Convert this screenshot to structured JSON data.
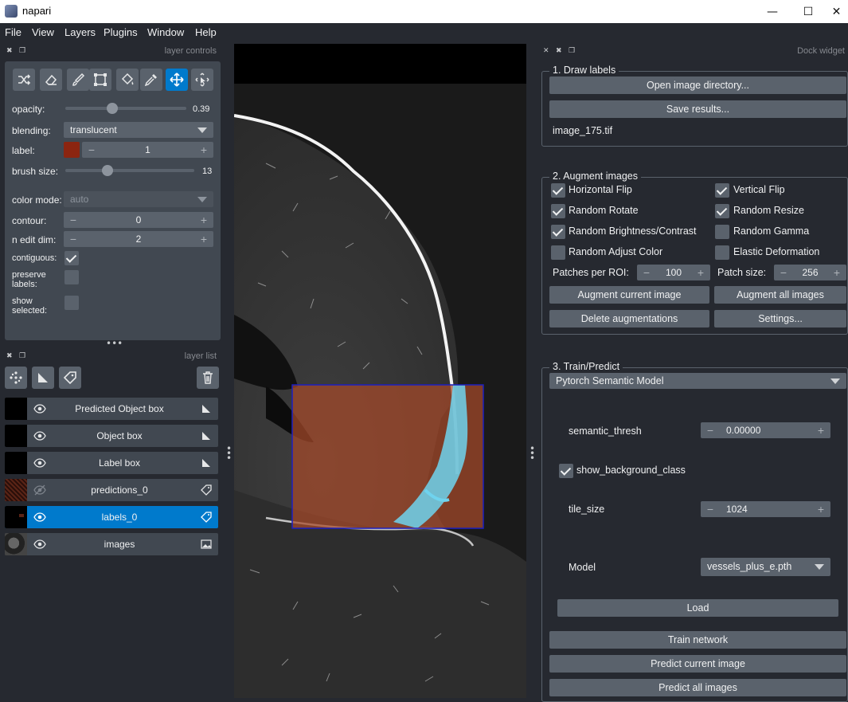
{
  "window": {
    "title": "napari",
    "minimize_icon": "minimize-icon",
    "maximize_icon": "maximize-icon",
    "close_icon": "close-icon"
  },
  "menu": [
    "File",
    "View",
    "Layers",
    "Plugins",
    "Window",
    "Help"
  ],
  "layer_controls": {
    "header": "layer controls",
    "tools": [
      "shuffle-colors-icon",
      "eraser-icon",
      "paintbrush-icon",
      "polygon-icon",
      "fill-bucket-icon",
      "color-picker-icon",
      "pan-zoom-icon",
      "transform-icon"
    ],
    "active_tool": "pan-zoom-icon",
    "opacity_label": "opacity:",
    "opacity_value": "0.39",
    "opacity_fraction": 0.39,
    "blending_label": "blending:",
    "blending_value": "translucent",
    "label_label": "label:",
    "label_value": "1",
    "label_color": "#8b2510",
    "brush_label": "brush size:",
    "brush_value": "13",
    "brush_fraction": 0.33,
    "color_mode_label": "color mode:",
    "color_mode_value": "auto",
    "contour_label": "contour:",
    "contour_value": "0",
    "n_edit_label": "n edit dim:",
    "n_edit_value": "2",
    "contiguous_label": "contiguous:",
    "contiguous_checked": true,
    "preserve_label_1": "preserve",
    "preserve_label_2": "labels:",
    "preserve_checked": false,
    "show_label_1": "show",
    "show_label_2": "selected:",
    "show_checked": false
  },
  "layer_list": {
    "header": "layer list",
    "buttons": [
      "new-points-icon",
      "new-shapes-icon",
      "new-labels-icon",
      "delete-layer-icon"
    ],
    "layers": [
      {
        "name": "Predicted Object box",
        "visible": true,
        "type": "shapes",
        "selected": false
      },
      {
        "name": "Object box",
        "visible": true,
        "type": "shapes",
        "selected": false
      },
      {
        "name": "Label box",
        "visible": true,
        "type": "shapes",
        "selected": false
      },
      {
        "name": "predictions_0",
        "visible": false,
        "type": "labels",
        "selected": false
      },
      {
        "name": "labels_0",
        "visible": true,
        "type": "labels",
        "selected": true
      },
      {
        "name": "images",
        "visible": true,
        "type": "image",
        "selected": false
      }
    ]
  },
  "dock": {
    "header": "Dock widget",
    "draw": {
      "title": "1. Draw labels",
      "open_btn": "Open image directory...",
      "save_btn": "Save results...",
      "filename": "image_175.tif"
    },
    "augment": {
      "title": "2. Augment images",
      "checks": [
        {
          "label": "Horizontal Flip",
          "checked": true
        },
        {
          "label": "Vertical Flip",
          "checked": true
        },
        {
          "label": "Random Rotate",
          "checked": true
        },
        {
          "label": "Random Resize",
          "checked": true
        },
        {
          "label": "Random Brightness/Contrast",
          "checked": true
        },
        {
          "label": "Random Gamma",
          "checked": false
        },
        {
          "label": "Random Adjust Color",
          "checked": false
        },
        {
          "label": "Elastic Deformation",
          "checked": false
        }
      ],
      "patches_label": "Patches per ROI:",
      "patches_value": "100",
      "patch_size_label": "Patch size:",
      "patch_size_value": "256",
      "augment_current": "Augment current image",
      "augment_all": "Augment all images",
      "delete_aug": "Delete augmentations",
      "settings": "Settings..."
    },
    "train": {
      "title": "3. Train/Predict",
      "model_type": "Pytorch Semantic Model",
      "semantic_label": "semantic_thresh",
      "semantic_value": "0.00000",
      "show_bg_label": "show_background_class",
      "show_bg_checked": true,
      "tile_label": "tile_size",
      "tile_value": "1024",
      "model_label": "Model",
      "model_value": "vessels_plus_e.pth",
      "load_btn": "Load",
      "train_btn": "Train network",
      "predict_current": "Predict current image",
      "predict_all": "Predict all images"
    }
  },
  "colors": {
    "background": "#262930",
    "panel": "#414851",
    "control": "#5a626c",
    "accent": "#007acc",
    "roi_box": "#1c1fbf",
    "label_overlay": "#a64a2a",
    "prediction_overlay": "#6fd3ee"
  }
}
